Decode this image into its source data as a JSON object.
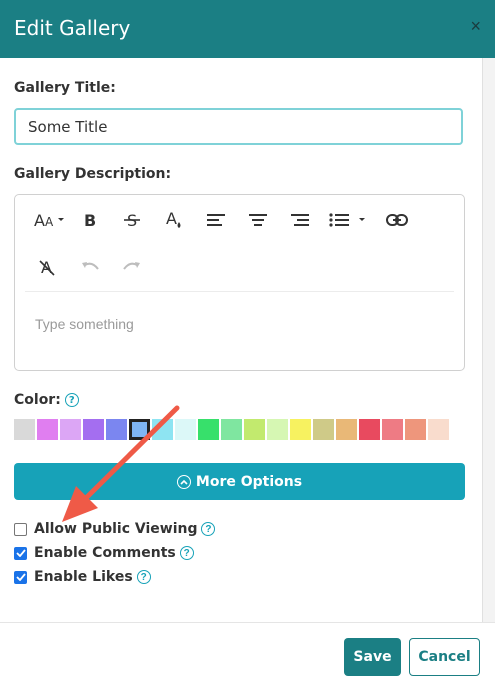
{
  "dialog": {
    "title": "Edit Gallery",
    "close_symbol": "×"
  },
  "form": {
    "gallery_title_label": "Gallery Title:",
    "gallery_title_value": "Some Title",
    "gallery_description_label": "Gallery Description:",
    "editor_placeholder": "Type something",
    "toolbar_icons": [
      "font-size-icon",
      "bold-icon",
      "strikethrough-icon",
      "text-color-icon",
      "align-left-icon",
      "align-center-icon",
      "align-right-icon",
      "list-icon",
      "link-icon",
      "clear-format-icon",
      "undo-icon",
      "redo-icon"
    ],
    "color_label": "Color:",
    "swatches": [
      {
        "color": "#d9d9d9",
        "selected": false
      },
      {
        "color": "#e07ef0",
        "selected": false
      },
      {
        "color": "#dca6f5",
        "selected": false
      },
      {
        "color": "#a46ef0",
        "selected": false
      },
      {
        "color": "#7b86f0",
        "selected": false
      },
      {
        "color": "#7fb6f5",
        "selected": true
      },
      {
        "color": "#8ee4f2",
        "selected": false
      },
      {
        "color": "#dcf8f8",
        "selected": false
      },
      {
        "color": "#37e06b",
        "selected": false
      },
      {
        "color": "#7fe6a0",
        "selected": false
      },
      {
        "color": "#c2ea6e",
        "selected": false
      },
      {
        "color": "#d6f7b3",
        "selected": false
      },
      {
        "color": "#f7f260",
        "selected": false
      },
      {
        "color": "#cfca88",
        "selected": false
      },
      {
        "color": "#e9b877",
        "selected": false
      },
      {
        "color": "#e84a5f",
        "selected": false
      },
      {
        "color": "#ee7b84",
        "selected": false
      },
      {
        "color": "#ee967c",
        "selected": false
      },
      {
        "color": "#f9dccd",
        "selected": false
      }
    ],
    "more_options_label": "More Options",
    "options": [
      {
        "label": "Allow Public Viewing",
        "checked": false
      },
      {
        "label": "Enable Comments",
        "checked": true
      },
      {
        "label": "Enable Likes",
        "checked": true
      }
    ],
    "help_symbol": "?"
  },
  "footer": {
    "save_label": "Save",
    "cancel_label": "Cancel"
  },
  "colors": {
    "header": "#1b7f84",
    "accent": "#17a2b8",
    "arrow": "#ef5a47"
  }
}
